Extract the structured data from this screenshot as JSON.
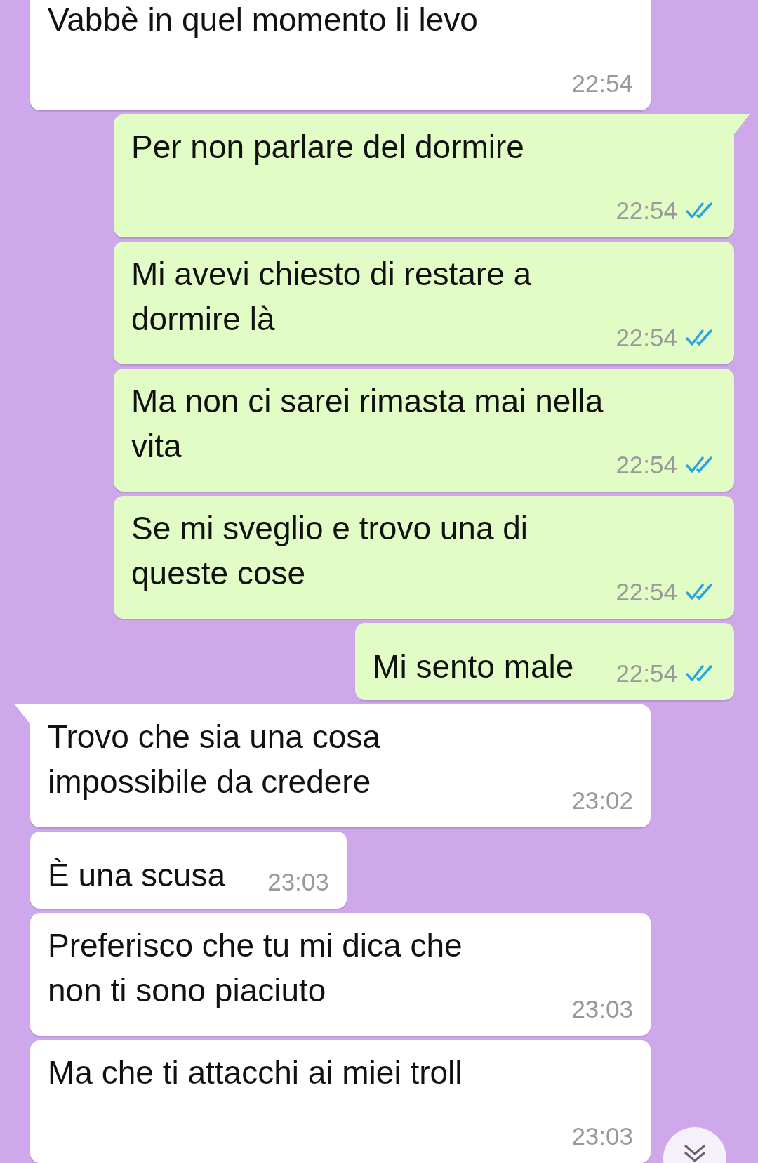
{
  "messages": [
    {
      "kind": "incoming",
      "text": "Vabbè in quel momento li levo",
      "time": "22:54"
    },
    {
      "kind": "outgoing",
      "tail": true,
      "text": "Per non parlare del dormire",
      "time": "22:54",
      "read": true
    },
    {
      "kind": "outgoing",
      "tail": false,
      "text": "Mi avevi chiesto di restare a dormire là",
      "time": "22:54",
      "read": true
    },
    {
      "kind": "outgoing",
      "tail": false,
      "text": "Ma non ci sarei rimasta mai nella vita",
      "time": "22:54",
      "read": true
    },
    {
      "kind": "outgoing",
      "tail": false,
      "text": "Se mi sveglio e trovo una di queste cose",
      "time": "22:54",
      "read": true
    },
    {
      "kind": "outgoing",
      "tail": false,
      "text": "Mi sento male",
      "time": "22:54",
      "read": true
    },
    {
      "kind": "incoming",
      "tail": true,
      "text": "Trovo che sia una cosa impossibile da credere",
      "time": "23:02"
    },
    {
      "kind": "incoming",
      "tail": false,
      "text": "È una scusa",
      "time": "23:03"
    },
    {
      "kind": "incoming",
      "tail": false,
      "text": "Preferisco che tu mi dica che non ti sono piaciuto",
      "time": "23:03"
    },
    {
      "kind": "incoming",
      "tail": false,
      "text": "Ma che ti attacchi ai miei troll",
      "time": "23:03"
    }
  ]
}
